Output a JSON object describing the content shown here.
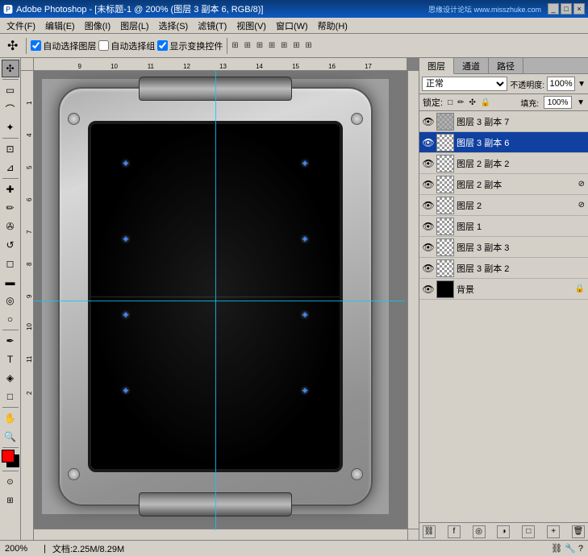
{
  "titlebar": {
    "title": "Adobe Photoshop - [未标题-1 @ 200% (图层 3 副本 6, RGB/8)]",
    "app": "Adobe Photoshop",
    "site": "思缘设计论坛 www.misszhuke.com",
    "controls": [
      "_",
      "□",
      "×"
    ]
  },
  "menubar": {
    "items": [
      "文件(F)",
      "编辑(E)",
      "图像(I)",
      "图层(L)",
      "选择(S)",
      "滤镜(T)",
      "视图(V)",
      "窗口(W)",
      "帮助(H)"
    ]
  },
  "toolbar": {
    "checkbox1": "自动选择图层",
    "checkbox2": "自动选择组",
    "checkbox3": "显示变换控件"
  },
  "tools": [
    {
      "name": "move-tool",
      "icon": "✣"
    },
    {
      "name": "marquee-tool",
      "icon": "▭"
    },
    {
      "name": "lasso-tool",
      "icon": "⌒"
    },
    {
      "name": "magic-wand",
      "icon": "✦"
    },
    {
      "name": "crop-tool",
      "icon": "⊡"
    },
    {
      "name": "eyedropper",
      "icon": "⊿"
    },
    {
      "name": "heal-tool",
      "icon": "✚"
    },
    {
      "name": "brush-tool",
      "icon": "⬌"
    },
    {
      "name": "clone-tool",
      "icon": "✇"
    },
    {
      "name": "history-brush",
      "icon": "↺"
    },
    {
      "name": "eraser-tool",
      "icon": "◻"
    },
    {
      "name": "gradient-tool",
      "icon": "◼"
    },
    {
      "name": "blur-tool",
      "icon": "💧"
    },
    {
      "name": "dodge-tool",
      "icon": "○"
    },
    {
      "name": "pen-tool",
      "icon": "✒"
    },
    {
      "name": "text-tool",
      "icon": "T"
    },
    {
      "name": "path-tool",
      "icon": "◈"
    },
    {
      "name": "shape-tool",
      "icon": "□"
    },
    {
      "name": "hand-tool",
      "icon": "✋"
    },
    {
      "name": "zoom-tool",
      "icon": "🔍"
    }
  ],
  "layers_panel": {
    "tabs": [
      "图层",
      "通道",
      "路径"
    ],
    "active_tab": "图层",
    "blend_mode": "正常",
    "opacity_label": "不透明度:",
    "opacity_value": "100%",
    "lock_label": "锁定:",
    "fill_label": "填充:",
    "fill_value": "100%",
    "layers": [
      {
        "name": "图层 3 副本 7",
        "visible": true,
        "selected": false,
        "type": "normal",
        "lock": false
      },
      {
        "name": "图层 3 副本 6",
        "visible": true,
        "selected": true,
        "type": "normal",
        "lock": false
      },
      {
        "name": "图层 2 副本 2",
        "visible": true,
        "selected": false,
        "type": "normal",
        "lock": false
      },
      {
        "name": "图层 2 副本",
        "visible": true,
        "selected": false,
        "type": "normal",
        "lock": true
      },
      {
        "name": "图层 2",
        "visible": true,
        "selected": false,
        "type": "normal",
        "lock": true
      },
      {
        "name": "图层 1",
        "visible": true,
        "selected": false,
        "type": "normal",
        "lock": false
      },
      {
        "name": "图层 3 副本 3",
        "visible": true,
        "selected": false,
        "type": "normal",
        "lock": false
      },
      {
        "name": "图层 3 副本 2",
        "visible": true,
        "selected": false,
        "type": "normal",
        "lock": false
      },
      {
        "name": "背景",
        "visible": true,
        "selected": false,
        "type": "background",
        "lock": true
      }
    ]
  },
  "statusbar": {
    "zoom": "200%",
    "doc_info": "文档:2.25M/8.29M"
  },
  "canvas": {
    "guides": true,
    "zoom": "200%"
  }
}
